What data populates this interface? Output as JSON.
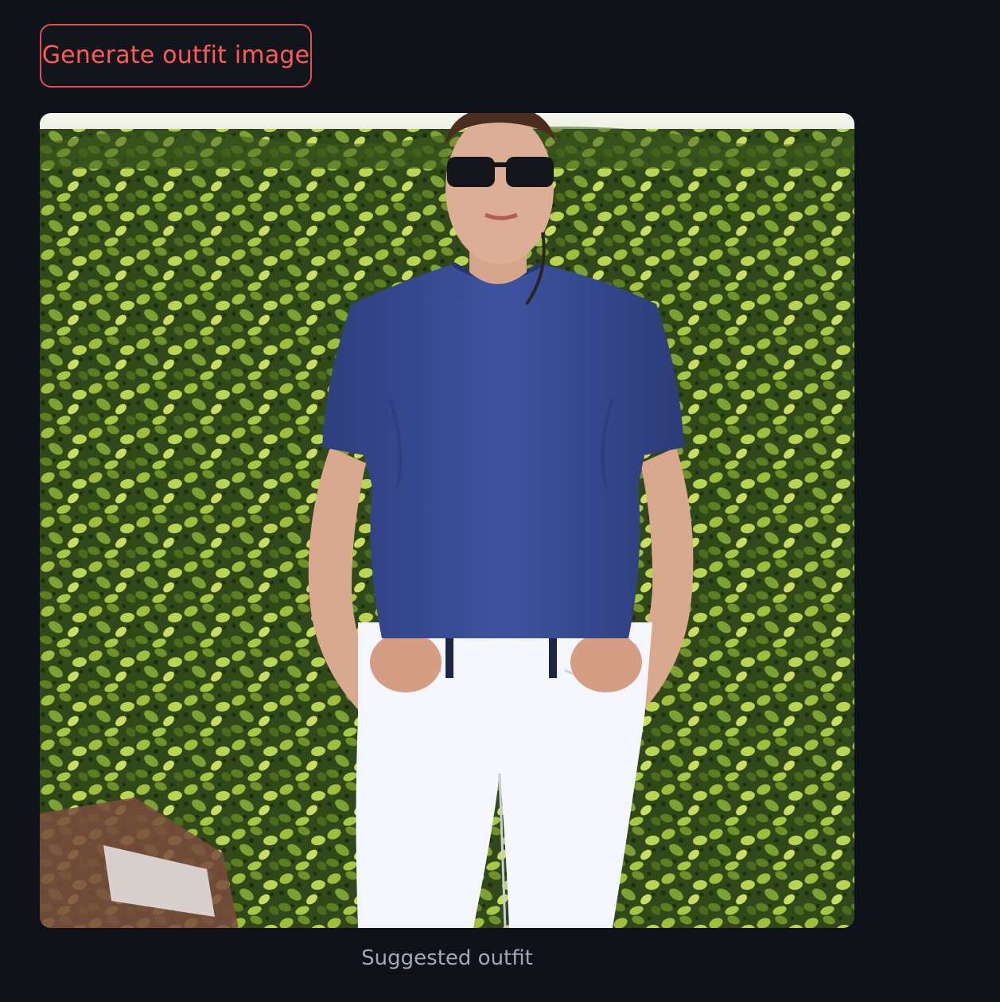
{
  "button": {
    "label": "Generate outfit image"
  },
  "image": {
    "alt": "Suggested outfit"
  },
  "caption": "Suggested outfit",
  "colors": {
    "background": "#0e1117",
    "accent": "#ff5a55",
    "caption": "#a3a8b8"
  }
}
